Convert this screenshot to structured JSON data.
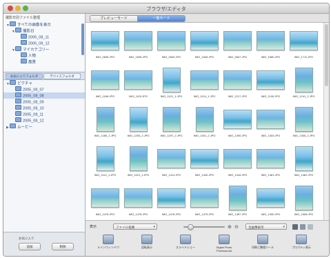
{
  "window": {
    "title": "ブラウザ/エディタ"
  },
  "tabs": [
    {
      "label": "プレビューモード"
    },
    {
      "label": "一覧モード"
    }
  ],
  "sidebar": {
    "header": "撮影日別ファイル整理",
    "tree_top": [
      {
        "label": "すべての画像を表示",
        "indent": 0,
        "tri": "▼"
      },
      {
        "label": "撮影日",
        "indent": 1,
        "tri": "▼"
      },
      {
        "label": "2005_08_11",
        "indent": 2,
        "tri": ""
      },
      {
        "label": "2005_08_12",
        "indent": 2,
        "tri": ""
      },
      {
        "label": "マイカテゴリー",
        "indent": 1,
        "tri": "▼"
      },
      {
        "label": "人物",
        "indent": 2,
        "tri": ""
      },
      {
        "label": "風景",
        "indent": 2,
        "tri": ""
      }
    ],
    "tabs": [
      {
        "label": "お気に入りフォルダ"
      },
      {
        "label": "デバイスフォルダ"
      }
    ],
    "tree_bottom": [
      {
        "label": "ピクチャ",
        "indent": 0,
        "tri": "▼",
        "selected": false
      },
      {
        "label": "2005_08_07",
        "indent": 1,
        "tri": "",
        "selected": false
      },
      {
        "label": "2005_08_08",
        "indent": 1,
        "tri": "",
        "selected": true
      },
      {
        "label": "2005_08_09",
        "indent": 1,
        "tri": "",
        "selected": false
      },
      {
        "label": "2005_08_10",
        "indent": 1,
        "tri": "",
        "selected": false
      },
      {
        "label": "2005_08_11",
        "indent": 1,
        "tri": "",
        "selected": false
      },
      {
        "label": "2005_08_12",
        "indent": 1,
        "tri": "",
        "selected": false
      },
      {
        "label": "ムービー",
        "indent": 0,
        "tri": "▶",
        "selected": false
      }
    ],
    "footer": {
      "label": "お気に入り",
      "btn_add": "追加",
      "btn_remove": "削除"
    }
  },
  "thumbnails": [
    [
      {
        "name": "IMG_0635.JPG",
        "orient": "land"
      },
      {
        "name": "IMG_1635.JPG",
        "orient": "land"
      },
      {
        "name": "IMG_0640.JPG",
        "orient": "land"
      },
      {
        "name": "IMG_1645.JPG",
        "orient": "land"
      },
      {
        "name": "IMG_0647.JPG",
        "orient": "land"
      },
      {
        "name": "IMG_1650.JPG",
        "orient": "land"
      },
      {
        "name": "IMG_1711.JPG",
        "orient": "land"
      }
    ],
    [
      {
        "name": "IMG_1048.JPG",
        "orient": "land"
      },
      {
        "name": "IMG_1115.JPG",
        "orient": "land"
      },
      {
        "name": "IMG_1121_1.JPG",
        "orient": "port"
      },
      {
        "name": "IMG_1124_1.JPG",
        "orient": "land"
      },
      {
        "name": "IMG_1217.JPG",
        "orient": "land"
      },
      {
        "name": "IMG_1190.JPG",
        "orient": "land"
      },
      {
        "name": "IMG_1241_2.JPG",
        "orient": "port"
      }
    ],
    [
      {
        "name": "IMG_1280_2.JPG",
        "orient": "port"
      },
      {
        "name": "IMG_1293_2.JPG",
        "orient": "port"
      },
      {
        "name": "IMG_1297_2.JPG",
        "orient": "port"
      },
      {
        "name": "IMG_1301_2.JPG",
        "orient": "port"
      },
      {
        "name": "IMG_1390.JPG",
        "orient": "land"
      },
      {
        "name": "IMG_1303.JPG",
        "orient": "land"
      },
      {
        "name": "IMG_1305_2.JPG",
        "orient": "port"
      }
    ],
    [
      {
        "name": "IMG_1112_1.JPG",
        "orient": "port"
      },
      {
        "name": "IMG_1119_1.JPG",
        "orient": "port"
      },
      {
        "name": "IMG_1411.JPG",
        "orient": "land"
      },
      {
        "name": "IMG_1440.JPG",
        "orient": "land"
      },
      {
        "name": "IMG_1416.JPG",
        "orient": "land"
      },
      {
        "name": "IMG_1461.JPG",
        "orient": "land"
      },
      {
        "name": "IMG_1462.JPG",
        "orient": "port"
      }
    ],
    [
      {
        "name": "IMG_1476.JPG",
        "orient": "land"
      },
      {
        "name": "IMG_1478.JPG",
        "orient": "land"
      },
      {
        "name": "IMG_1478.JPG",
        "orient": "land"
      },
      {
        "name": "IMG_1475.JPG",
        "orient": "land"
      },
      {
        "name": "IMG_1487.JPG",
        "orient": "port"
      },
      {
        "name": "IMG_1490.JPG",
        "orient": "land"
      },
      {
        "name": "IMG_1508.JPG",
        "orient": "port"
      }
    ]
  ],
  "bottombar": {
    "display_label": "表示",
    "sort_value": "ファイル名順",
    "filter_value": "全画像表示",
    "actions": [
      {
        "label": "メインウィンドウ"
      },
      {
        "label": "回転表示"
      },
      {
        "label": "スライドショー"
      },
      {
        "label": "Digital Photo Professional"
      },
      {
        "label": "印刷と整理ツール"
      },
      {
        "label": "プロパティ表示"
      }
    ]
  }
}
